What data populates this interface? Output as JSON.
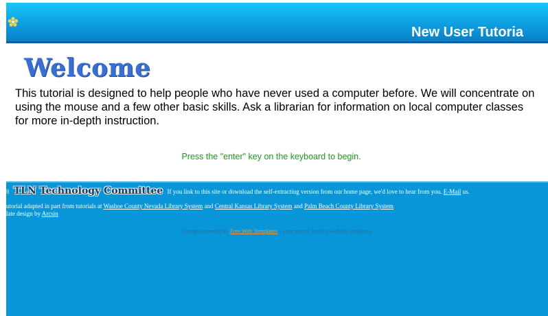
{
  "header": {
    "logo_icon": "flower-icon",
    "title": "New User Tutoria",
    "gradient_colors": [
      "#19c5f6",
      "#0a7fc8"
    ]
  },
  "main": {
    "heading": "Welcome",
    "intro": "This tutorial is designed to help people who have never used a computer before. We will concentrate on using the mouse and a few other basic skills. Ask a librarian for information on local computer classes for more in-depth instruction.",
    "prompt": "Press the \"enter\" key on the keyboard to begin.",
    "heading_color": "#3a6fd0",
    "prompt_color": "#1a9a1a"
  },
  "footer": {
    "year_fragment": "8",
    "committee": "TLN Technology Committee",
    "link_note": "If you link to this site or download the self-extracting version from our home page, we'd love to hear from you.",
    "email_link": "E-Mail",
    "email_suffix": "us.",
    "adapted_prefix": "utorial adapted in part from tutorials at",
    "links": [
      "Washoe County Nevada Library System",
      "Central Kansas Library System",
      "Palm Beach County Library System"
    ],
    "and_1": "and",
    "and_2": "and",
    "design_prefix": "late design by",
    "design_link": "Arcsin",
    "credits_prefix": "Design provided by",
    "credits_link": "Free Web Templates",
    "credits_suffix": "- your source for free website templates",
    "background_color": "#0996d8"
  }
}
